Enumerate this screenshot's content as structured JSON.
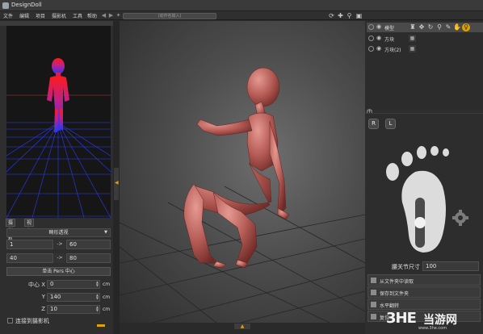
{
  "window": {
    "title": "DesignDoll"
  },
  "menubar": {
    "items": [
      "文件",
      "编辑",
      "项目",
      "摄影机",
      "工具",
      "帮助"
    ],
    "search_placeholder": "(动作名输入)"
  },
  "left_panel": {
    "tabs": [
      "摄影机",
      "视角"
    ],
    "projection": "畸形透视",
    "range_rows": [
      {
        "from": "1",
        "arrow": "->",
        "to": "60"
      },
      {
        "from": "40",
        "arrow": "->",
        "to": "80"
      }
    ],
    "pivot_button": "单击 Pers 中心",
    "center_fields": [
      {
        "label": "中心 X",
        "value": "0",
        "unit": "cm"
      },
      {
        "label": "Y",
        "value": "140",
        "unit": "cm"
      },
      {
        "label": "Z",
        "value": "10",
        "unit": "cm"
      }
    ],
    "connect_checkbox": "连接到摄影机"
  },
  "scene": {
    "rows": [
      {
        "label": "模型"
      },
      {
        "label": "方块"
      },
      {
        "label": "方块(2)"
      }
    ]
  },
  "hand_panel": {
    "left_button": "R",
    "right_button": "L",
    "joint_size_label": "腰关节尺寸",
    "joint_size_value": "100",
    "slider_level": 0.5
  },
  "actions": [
    "从文件夹中读取",
    "保存到文件夹",
    "水平翻转",
    "复位"
  ],
  "watermark": {
    "logo": "3HE",
    "site": "当游网",
    "url": "www.3he.com"
  },
  "colors": {
    "accent": "#e2a300",
    "figure": "#b85c57",
    "grid": "#2a3cff"
  }
}
